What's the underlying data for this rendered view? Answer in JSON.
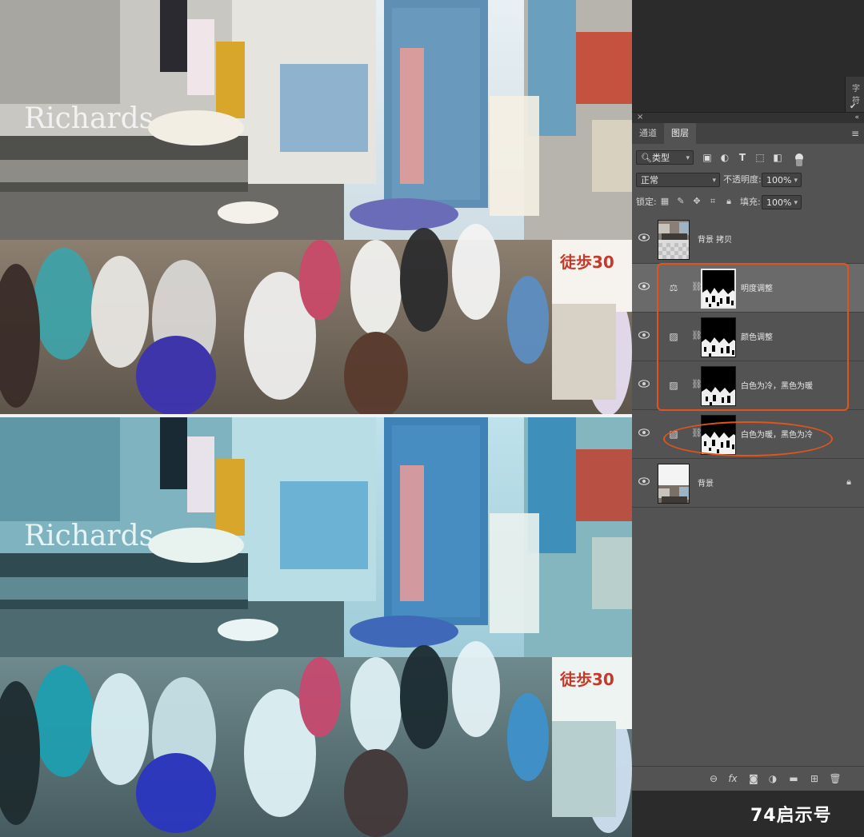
{
  "panel": {
    "tabs": [
      {
        "label": "通道",
        "active": false
      },
      {
        "label": "图层",
        "active": true
      }
    ],
    "side_tab": "字符",
    "filter": {
      "value": "类型"
    },
    "blend_mode": {
      "value": "正常"
    },
    "opacity": {
      "label": "不透明度:",
      "value": "100%"
    },
    "lock": {
      "label": "锁定:"
    },
    "fill": {
      "label": "填充:",
      "value": "100%"
    }
  },
  "layers": [
    {
      "name": "背景 拷贝",
      "type": "pixel",
      "visible": true
    },
    {
      "name": "明度调整",
      "type": "adjustment",
      "icon": "balance-icon",
      "visible": true,
      "selected": true
    },
    {
      "name": "颜色调整",
      "type": "adjustment",
      "icon": "curves-icon",
      "visible": true
    },
    {
      "name": "白色为冷，黑色为暖",
      "type": "adjustment",
      "icon": "curves-icon",
      "visible": true
    },
    {
      "name": "白色为暖，黑色为冷",
      "type": "adjustment",
      "icon": "curves-icon",
      "visible": true
    },
    {
      "name": "背景",
      "type": "background",
      "visible": true,
      "locked": true
    }
  ],
  "bottom_bar_icons": [
    "link-icon",
    "fx-icon",
    "mask-icon",
    "adjustment-icon",
    "folder-icon",
    "new-layer-icon",
    "trash-icon"
  ],
  "annotation_color": "#e2541c",
  "watermark": "74启示号"
}
